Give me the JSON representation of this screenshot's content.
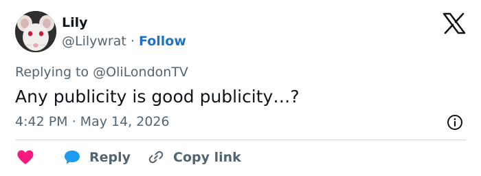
{
  "author": {
    "name": "Lily",
    "handle": "@Lilywrat",
    "separator": "·",
    "follow_label": "Follow"
  },
  "tweet": {
    "replying_prefix": "Replying to",
    "replying_to": "@OliLondonTV",
    "text": "Any publicity is good publicity…?",
    "timestamp": "4:42 PM · May 14, 2026"
  },
  "actions": {
    "like_icon": "heart-icon",
    "reply_label": "Reply",
    "copy_label": "Copy link"
  },
  "icons": {
    "logo": "x-logo-icon",
    "info": "info-icon",
    "reply": "speech-bubble-icon",
    "copy": "link-icon"
  },
  "colors": {
    "link": "#1d72c4",
    "muted": "#536471",
    "text": "#0f1419",
    "heart": "#f91880",
    "reply_bubble": "#1d9bf0",
    "divider": "#cfd9de"
  }
}
